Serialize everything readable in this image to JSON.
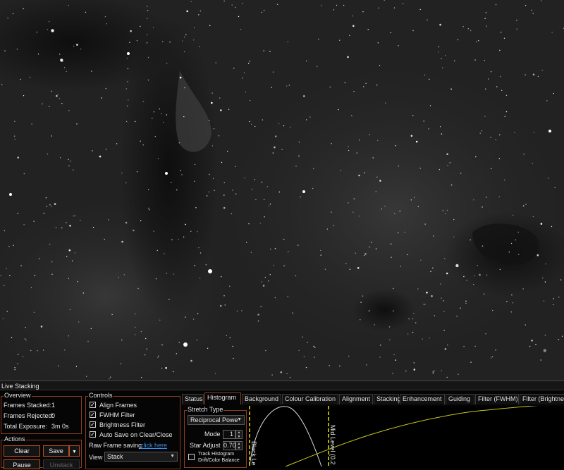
{
  "panel": {
    "title": "Live Stacking"
  },
  "overview": {
    "label": "Overview",
    "rows": [
      {
        "label": "Frames Stacked:",
        "value": "1"
      },
      {
        "label": "Frames Rejected:",
        "value": "0"
      },
      {
        "label": "Total Exposure:",
        "value": "3m 0s"
      }
    ]
  },
  "actions": {
    "label": "Actions",
    "clear": "Clear",
    "save": "Save",
    "pause": "Pause",
    "unstack": "Unstack"
  },
  "controls": {
    "label": "Controls",
    "checks": [
      {
        "label": "Align Frames",
        "checked": true
      },
      {
        "label": "FWHM Filter",
        "checked": true
      },
      {
        "label": "Brightness Filter",
        "checked": true
      },
      {
        "label": "Auto Save on Clear/Close",
        "checked": true
      }
    ],
    "raw_frame_label": "Raw Frame saving",
    "raw_frame_link": "click here",
    "view_label": "View",
    "view_value": "Stack"
  },
  "tabs": [
    "Status",
    "Histogram",
    "Background",
    "Colour Calibration",
    "Alignment",
    "Stacking",
    "Enhancement",
    "Guiding",
    "Filter (FWHM)",
    "Filter (Brightness)"
  ],
  "active_tab": 1,
  "stretch": {
    "label": "Stretch Type",
    "type_value": "Reciprocal Powe",
    "mode_label": "Mode",
    "mode_value": "1",
    "star_adjust_label": "Star Adjust",
    "star_adjust_value": "0.70",
    "track_label_1": "Track Histogram",
    "track_label_2": "Drift/Color Balance",
    "track_checked": false
  },
  "histogram": {
    "black_label": "Black Le",
    "mid_label": "Mid Level (0.2"
  },
  "colors": {
    "accent": "#b8501f",
    "curve_white": "#d8d8d8",
    "curve_yellow": "#c8c820",
    "marker_yellow": "#e6e600"
  }
}
